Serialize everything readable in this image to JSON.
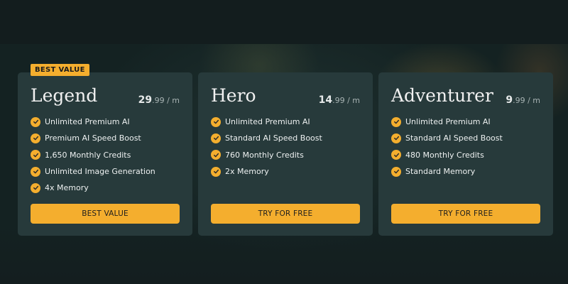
{
  "theme": {
    "accent": "#f4ae2e",
    "card_bg": "#273a3b",
    "page_bg": "#141e1f",
    "text": "#eef1f1",
    "check_icon": "check-circle-icon"
  },
  "plans": [
    {
      "badge": "BEST VALUE",
      "name": "Legend",
      "price_main": "29",
      "price_rest": ".99 / m",
      "features": [
        "Unlimited Premium AI",
        "Premium AI Speed Boost",
        "1,650 Monthly Credits",
        "Unlimited Image Generation",
        "4x Memory"
      ],
      "cta": "BEST VALUE"
    },
    {
      "name": "Hero",
      "price_main": "14",
      "price_rest": ".99 / m",
      "features": [
        "Unlimited Premium AI",
        "Standard AI Speed Boost",
        "760 Monthly Credits",
        "2x Memory"
      ],
      "cta": "TRY FOR FREE"
    },
    {
      "name": "Adventurer",
      "price_main": "9",
      "price_rest": ".99 / m",
      "features": [
        "Unlimited Premium AI",
        "Standard AI Speed Boost",
        "480 Monthly Credits",
        "Standard Memory"
      ],
      "cta": "TRY FOR FREE"
    }
  ]
}
